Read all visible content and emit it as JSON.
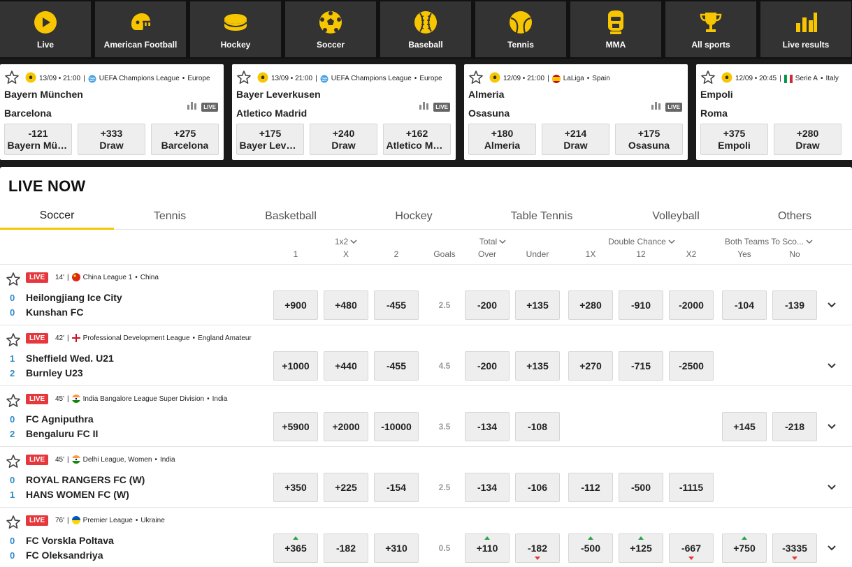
{
  "sports_nav": [
    {
      "label": "Live",
      "icon": "play-icon"
    },
    {
      "label": "American Football",
      "icon": "football-helmet-icon"
    },
    {
      "label": "Hockey",
      "icon": "hockey-puck-icon"
    },
    {
      "label": "Soccer",
      "icon": "soccer-ball-icon"
    },
    {
      "label": "Baseball",
      "icon": "baseball-icon"
    },
    {
      "label": "Tennis",
      "icon": "tennis-ball-icon"
    },
    {
      "label": "MMA",
      "icon": "mma-glove-icon"
    },
    {
      "label": "All sports",
      "icon": "trophy-icon"
    },
    {
      "label": "Live results",
      "icon": "bar-chart-icon"
    }
  ],
  "featured": [
    {
      "meta": "13/09 • 21:00",
      "league": "UEFA Champions League",
      "region": "Europe",
      "flag": "globe-icon",
      "team1": "Bayern München",
      "team2": "Barcelona",
      "live_label": "LIVE",
      "odds": [
        {
          "price": "-121",
          "label": "Bayern München"
        },
        {
          "price": "+333",
          "label": "Draw"
        },
        {
          "price": "+275",
          "label": "Barcelona"
        }
      ]
    },
    {
      "meta": "13/09 • 21:00",
      "league": "UEFA Champions League",
      "region": "Europe",
      "flag": "globe-icon",
      "team1": "Bayer Leverkusen",
      "team2": "Atletico Madrid",
      "live_label": "LIVE",
      "odds": [
        {
          "price": "+175",
          "label": "Bayer Leverkusen"
        },
        {
          "price": "+240",
          "label": "Draw"
        },
        {
          "price": "+162",
          "label": "Atletico Madrid"
        }
      ]
    },
    {
      "meta": "12/09 • 21:00",
      "league": "LaLiga",
      "region": "Spain",
      "flag": "spain-flag-icon",
      "team1": "Almeria",
      "team2": "Osasuna",
      "live_label": "LIVE",
      "odds": [
        {
          "price": "+180",
          "label": "Almeria"
        },
        {
          "price": "+214",
          "label": "Draw"
        },
        {
          "price": "+175",
          "label": "Osasuna"
        }
      ]
    },
    {
      "meta": "12/09 • 20:45",
      "league": "Serie A",
      "region": "Italy",
      "flag": "italy-flag-icon",
      "team1": "Empoli",
      "team2": "Roma",
      "live_label": "LIVE",
      "odds": [
        {
          "price": "+375",
          "label": "Empoli"
        },
        {
          "price": "+280",
          "label": "Draw"
        }
      ]
    }
  ],
  "live_now": {
    "title": "LIVE NOW",
    "tabs": [
      "Soccer",
      "Tennis",
      "Basketball",
      "Hockey",
      "Table Tennis",
      "Volleyball",
      "Others"
    ],
    "active_tab": "Soccer",
    "headers": {
      "group_1x2": "1x2",
      "group_total": "Total",
      "group_double": "Double Chance",
      "group_btts": "Both Teams To Sco...",
      "cols": [
        "1",
        "X",
        "2",
        "Goals",
        "Over",
        "Under",
        "1X",
        "12",
        "X2",
        "Yes",
        "No"
      ]
    },
    "live_badge": "LIVE",
    "matches": [
      {
        "minute": "14'",
        "flag": "china-flag-icon",
        "league": "China League 1",
        "region": "China",
        "home": {
          "score": "0",
          "name": "Heilongjiang Ice City"
        },
        "away": {
          "score": "0",
          "name": "Kunshan FC"
        },
        "odds": [
          "+900",
          "+480",
          "-455"
        ],
        "goals": "2.5",
        "total": [
          "-200",
          "+135"
        ],
        "double": [
          "+280",
          "-910",
          "-2000"
        ],
        "btts": [
          "-104",
          "-139"
        ],
        "moves": {}
      },
      {
        "minute": "42'",
        "flag": "england-flag-icon",
        "league": "Professional Development League",
        "region": "England Amateur",
        "home": {
          "score": "1",
          "name": "Sheffield Wed. U21"
        },
        "away": {
          "score": "2",
          "name": "Burnley U23"
        },
        "odds": [
          "+1000",
          "+440",
          "-455"
        ],
        "goals": "4.5",
        "total": [
          "-200",
          "+135"
        ],
        "double": [
          "+270",
          "-715",
          "-2500"
        ],
        "btts": [],
        "moves": {}
      },
      {
        "minute": "45'",
        "flag": "india-flag-icon",
        "league": "India Bangalore League Super Division",
        "region": "India",
        "home": {
          "score": "0",
          "name": "FC Agniputhra"
        },
        "away": {
          "score": "2",
          "name": "Bengaluru FC II"
        },
        "odds": [
          "+5900",
          "+2000",
          "-10000"
        ],
        "goals": "3.5",
        "total": [
          "-134",
          "-108"
        ],
        "double": [],
        "btts": [
          "+145",
          "-218"
        ],
        "moves": {}
      },
      {
        "minute": "45'",
        "flag": "india-flag-icon",
        "league": "Delhi League, Women",
        "region": "India",
        "home": {
          "score": "0",
          "name": "ROYAL RANGERS FC (W)"
        },
        "away": {
          "score": "1",
          "name": "HANS WOMEN FC (W)"
        },
        "odds": [
          "+350",
          "+225",
          "-154"
        ],
        "goals": "2.5",
        "total": [
          "-134",
          "-106"
        ],
        "double": [
          "-112",
          "-500",
          "-1115"
        ],
        "btts": [],
        "moves": {}
      },
      {
        "minute": "76'",
        "flag": "ukraine-flag-icon",
        "league": "Premier League",
        "region": "Ukraine",
        "home": {
          "score": "0",
          "name": "FC Vorskla Poltava"
        },
        "away": {
          "score": "0",
          "name": "FC Oleksandriya"
        },
        "odds": [
          "+365",
          "-182",
          "+310"
        ],
        "goals": "0.5",
        "total": [
          "+110",
          "-182"
        ],
        "double": [
          "-500",
          "+125",
          "-667"
        ],
        "btts": [
          "+750",
          "-3335"
        ],
        "moves": {
          "odds": [
            "up",
            "",
            ""
          ],
          "total": [
            "up",
            "down"
          ],
          "double": [
            "up",
            "up",
            "down"
          ],
          "btts": [
            "up",
            "down"
          ]
        }
      }
    ]
  },
  "colors": {
    "accent": "#f7c600",
    "live_red": "#e5373c",
    "score_blue": "#2e8bc7",
    "up_green": "#2aa14b"
  }
}
